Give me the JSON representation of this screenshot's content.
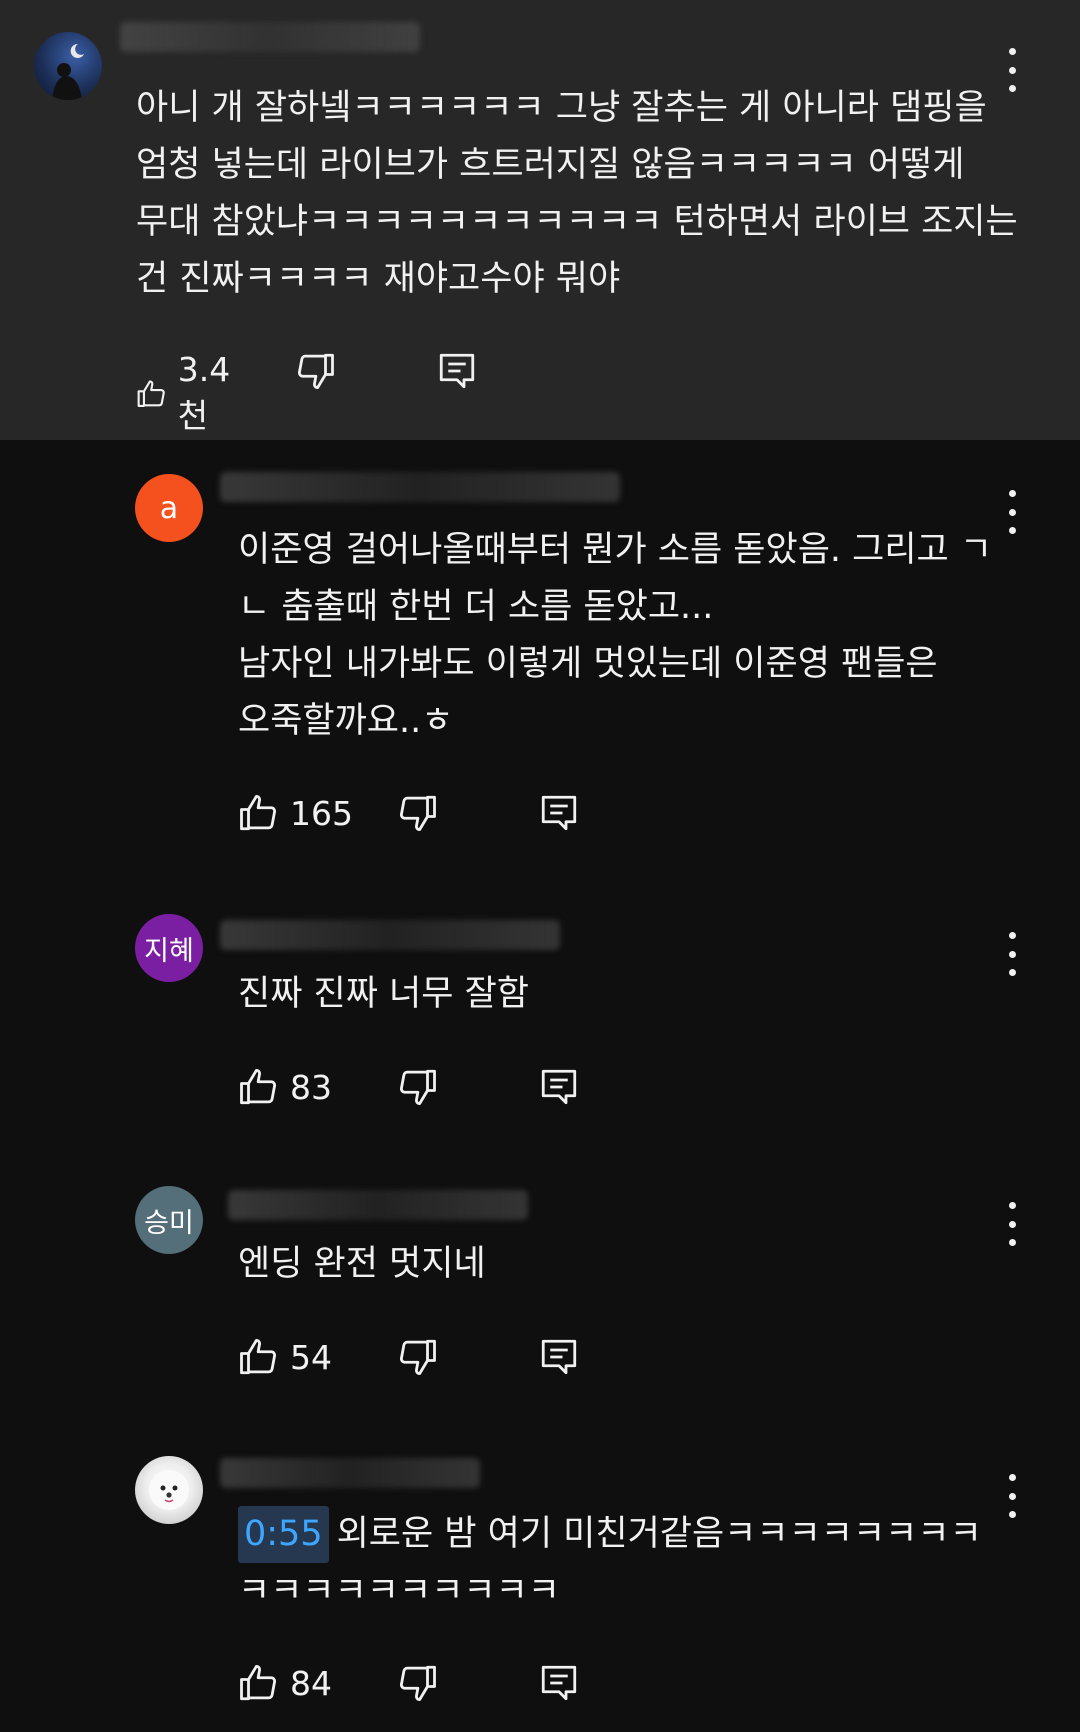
{
  "comments": [
    {
      "avatar": {
        "letter": "",
        "color": "#1c2f57"
      },
      "text": "아니 개 잘하넼ㅋㅋㅋㅋㅋㅋ  그냥 잘추는 게 아니라 댐핑을\n엄청 넣는데 라이브가 흐트러지질 않음ㅋㅋㅋㅋㅋ 어떻게\n무대 참았냐ㅋㅋㅋㅋㅋㅋㅋㅋㅋㅋㅋ 턴하면서 라이브 조지는\n건 진짜ㅋㅋㅋㅋ 재야고수야 뭐야",
      "likes": "3.4천"
    },
    {
      "avatar": {
        "letter": "a",
        "color": "#f4511e"
      },
      "text": "이준영 걸어나올때부터 뭔가 소름 돋았음. 그리고 ㄱ\nㄴ 춤출때 한번 더 소름 돋았고...\n남자인 내가봐도 이렇게 멋있는데 이준영 팬들은\n오죽할까요..ㅎ",
      "likes": "165"
    },
    {
      "avatar": {
        "letter": "지혜",
        "color": "#7b1fa2"
      },
      "text": "진짜 진짜 너무 잘함",
      "likes": "83"
    },
    {
      "avatar": {
        "letter": "승미",
        "color": "#546e7a"
      },
      "text": "엔딩 완전 멋지네",
      "likes": "54"
    },
    {
      "avatar": {
        "letter": "",
        "color": "#d9d9d9"
      },
      "timestamp": "0:55",
      "text": "외로운 밤 여기 미친거같음ㅋㅋㅋㅋㅋㅋㅋㅋ\nㅋㅋㅋㅋㅋㅋㅋㅋㅋㅋ",
      "likes": "84"
    }
  ],
  "icons": {
    "like": "thumbs-up-icon",
    "dislike": "thumbs-down-icon",
    "reply": "reply-icon",
    "more": "more-vert-icon"
  }
}
